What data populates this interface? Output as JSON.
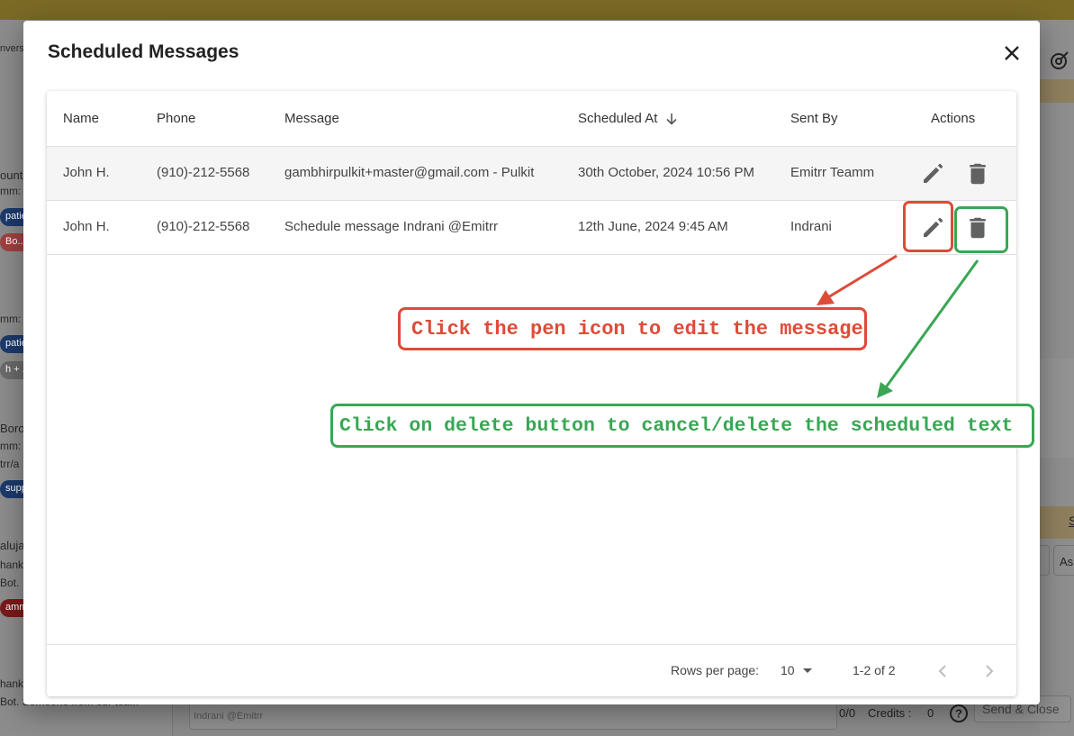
{
  "background": {
    "fragments": [
      "nvers",
      "ount",
      "mm:",
      "mm:",
      "Boro",
      "mm:",
      "trr/a",
      "aluja",
      "hank",
      "Bot.",
      "hank",
      "Bot. Someone from our tea..."
    ],
    "pills": [
      "patie",
      "Bo...",
      "patie",
      "h + ...",
      "supp",
      "amm"
    ],
    "right_labels": [
      "S",
      "As"
    ],
    "composer_placeholder": "Indrani @Emitrr",
    "char_count": "0/0",
    "credits_label": "Credits :",
    "credits_value": "0",
    "send_label": "Send & Close"
  },
  "dialog": {
    "title": "Scheduled Messages",
    "columns": {
      "name": "Name",
      "phone": "Phone",
      "message": "Message",
      "scheduled_at": "Scheduled At",
      "sent_by": "Sent By",
      "actions": "Actions"
    },
    "rows": [
      {
        "name": "John H.",
        "phone": "(910)-212-5568",
        "message": "gambhirpulkit+master@gmail.com - Pulkit",
        "scheduled_at": "30th October, 2024 10:56 PM",
        "sent_by": "Emitrr Teamm"
      },
      {
        "name": "John H.",
        "phone": "(910)-212-5568",
        "message": "Schedule message Indrani @Emitrr",
        "scheduled_at": "12th June, 2024 9:45 AM",
        "sent_by": "Indrani"
      }
    ],
    "pagination": {
      "rows_per_page_label": "Rows per page:",
      "rows_per_page": "10",
      "range": "1-2 of 2"
    }
  },
  "annotations": {
    "edit_callout": "Click the pen icon to edit the message",
    "delete_callout": "Click on delete button to cancel/delete the scheduled text",
    "edit_color": "#dd4b39",
    "delete_color": "#3aa655"
  },
  "colors": {
    "top_bar": "#7a6a26",
    "icon_gray": "#616161"
  }
}
